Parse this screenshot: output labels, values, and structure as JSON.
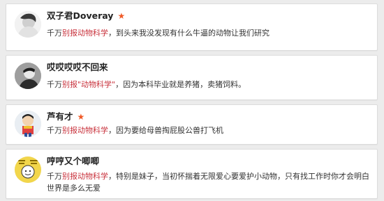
{
  "comments": [
    {
      "username": "双子君Doveray",
      "has_star": true,
      "star_icon": "star-icon",
      "prefix": "千万",
      "link_text": "别报动物科学",
      "body": "，到头来我没发现有什么牛逼的动物让我们研究"
    },
    {
      "username": "哎哎哎哎不回来",
      "has_star": false,
      "prefix": "千万",
      "link_text": "别报\"动物科学\"",
      "body": "，因为本科毕业就是养猪，卖猪饲料。"
    },
    {
      "username": "芦有才",
      "has_star": true,
      "star_icon": "star-icon",
      "prefix": "千万",
      "link_text": "别报动物科学",
      "body": "，因为要给母兽掏屁股公兽打飞机"
    },
    {
      "username": "哼哼又个唧唧",
      "has_star": false,
      "prefix": "千万",
      "link_text": "别报动物科学",
      "body": "，特别是妹子，当初怀揣着无限爱心要爱护小动物，只有找工作时你才会明白世界是多么无爱"
    }
  ],
  "colors": {
    "link": "#c8323c",
    "star": "#f05a28",
    "background": "#ececec",
    "card": "#ffffff"
  }
}
